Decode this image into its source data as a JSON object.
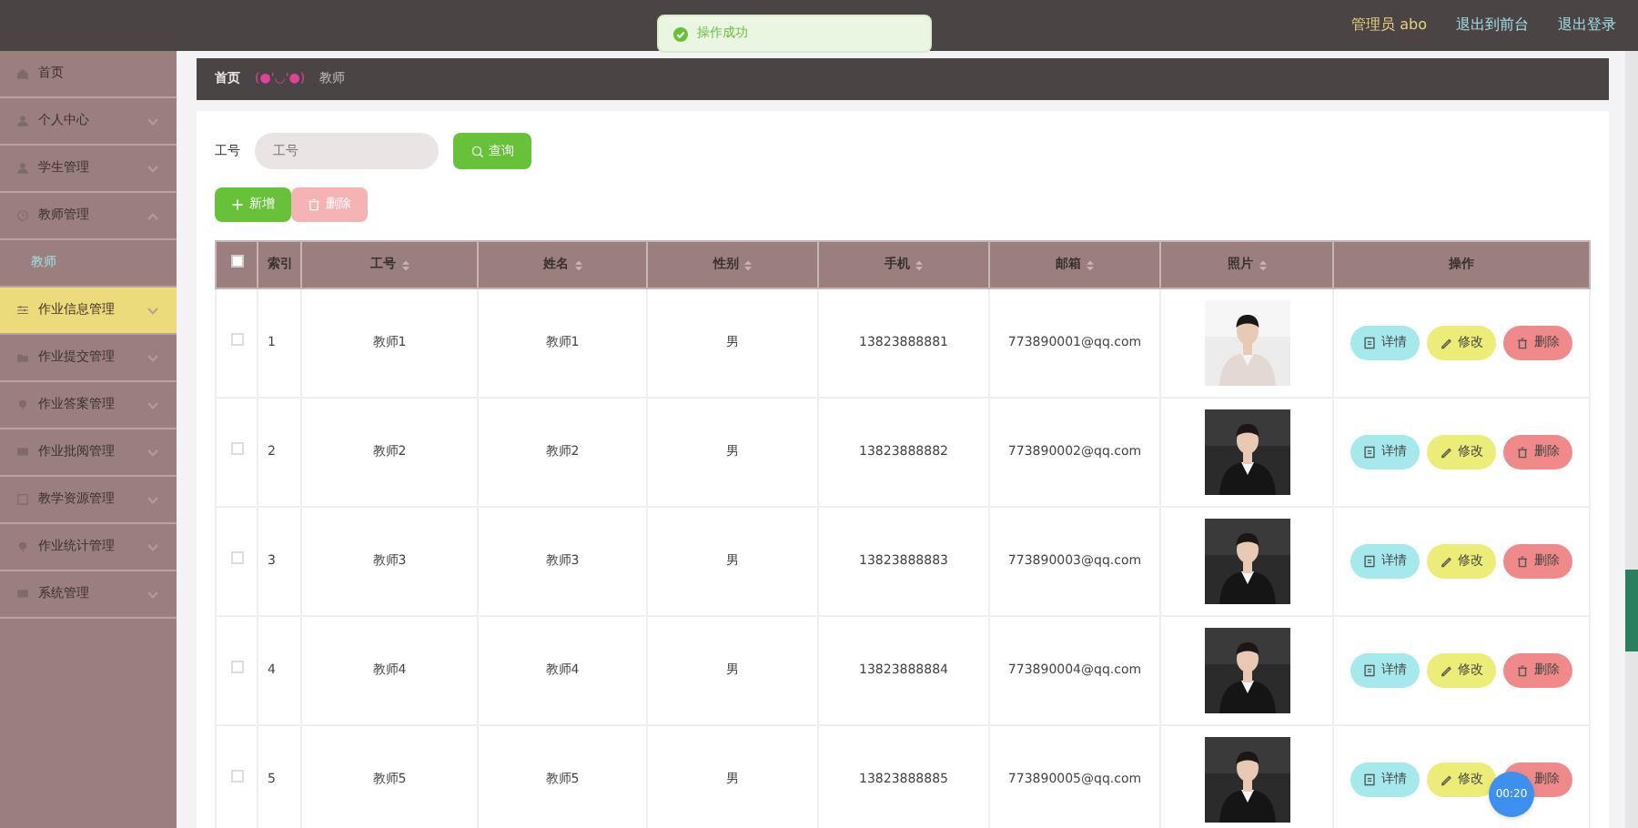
{
  "toast": {
    "text": "操作成功"
  },
  "header": {
    "user": "管理员 abo",
    "links": [
      "退出到前台",
      "退出登录"
    ]
  },
  "sidebar": {
    "items": [
      {
        "label": "首页",
        "selected": false
      },
      {
        "label": "个人中心",
        "selected": false,
        "expanded": false
      },
      {
        "label": "学生管理",
        "selected": false,
        "expanded": false
      },
      {
        "label": "教师管理",
        "selected": false,
        "expanded": true,
        "children": [
          {
            "label": "教师"
          }
        ]
      },
      {
        "label": "作业信息管理",
        "selected": true,
        "expanded": false
      },
      {
        "label": "作业提交管理",
        "selected": false,
        "expanded": false
      },
      {
        "label": "作业答案管理",
        "selected": false,
        "expanded": false
      },
      {
        "label": "作业批阅管理",
        "selected": false,
        "expanded": false
      },
      {
        "label": "教学资源管理",
        "selected": false,
        "expanded": false
      },
      {
        "label": "作业统计管理",
        "selected": false,
        "expanded": false
      },
      {
        "label": "系统管理",
        "selected": false,
        "expanded": false
      }
    ]
  },
  "breadcrumb": {
    "home": "首页",
    "separator": "(●'◡'●)",
    "current": "教师"
  },
  "search": {
    "label": "工号",
    "placeholder": "工号",
    "button": "查询"
  },
  "actions": {
    "add": "新增",
    "delete": "删除"
  },
  "table": {
    "all_checked": false,
    "columns": [
      {
        "label": "索引",
        "sortable": false
      },
      {
        "label": "工号",
        "sortable": true
      },
      {
        "label": "姓名",
        "sortable": true
      },
      {
        "label": "性别",
        "sortable": true
      },
      {
        "label": "手机",
        "sortable": true
      },
      {
        "label": "邮箱",
        "sortable": true
      },
      {
        "label": "照片",
        "sortable": true
      },
      {
        "label": "操作",
        "sortable": false
      }
    ],
    "rows": [
      {
        "index": "1",
        "id": "教师1",
        "name": "教师1",
        "gender": "男",
        "phone": "13823888881",
        "email": "773890001@qq.com",
        "checked": false,
        "actions": [
          "详情",
          "修改",
          "删除"
        ]
      },
      {
        "index": "2",
        "id": "教师2",
        "name": "教师2",
        "gender": "男",
        "phone": "13823888882",
        "email": "773890002@qq.com",
        "checked": false,
        "actions": [
          "详情",
          "修改",
          "删除"
        ]
      },
      {
        "index": "3",
        "id": "教师3",
        "name": "教师3",
        "gender": "男",
        "phone": "13823888883",
        "email": "773890003@qq.com",
        "checked": false,
        "actions": [
          "详情",
          "修改",
          "删除"
        ]
      },
      {
        "index": "4",
        "id": "教师4",
        "name": "教师4",
        "gender": "男",
        "phone": "13823888884",
        "email": "773890004@qq.com",
        "checked": false,
        "actions": [
          "详情",
          "修改",
          "删除"
        ]
      },
      {
        "index": "5",
        "id": "教师5",
        "name": "教师5",
        "gender": "男",
        "phone": "13823888885",
        "email": "773890005@qq.com",
        "checked": false,
        "actions": [
          "详情",
          "修改",
          "删除"
        ]
      }
    ]
  },
  "timer": "00:20"
}
